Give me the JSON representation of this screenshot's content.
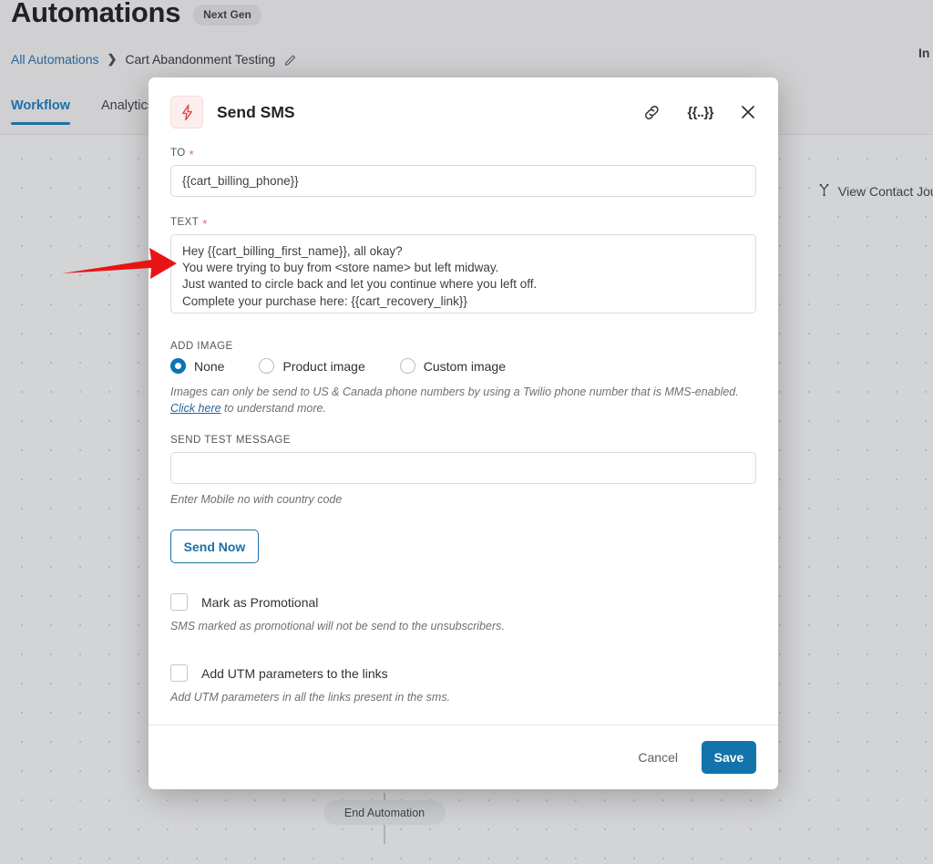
{
  "header": {
    "title": "Automations",
    "badge": "Next Gen",
    "right_cut_text": "In",
    "breadcrumb": {
      "root": "All Automations",
      "separator": "❯",
      "current": "Cart Abandonment Testing",
      "edit_icon": "pencil-icon"
    },
    "tabs": [
      {
        "label": "Workflow",
        "active": true
      },
      {
        "label": "Analytics",
        "active": false
      }
    ]
  },
  "canvas": {
    "view_journey_label": "View Contact Jour",
    "view_journey_icon": "branch-icon",
    "end_node_label": "End Automation"
  },
  "modal": {
    "icon": "lightning-bolt-icon",
    "title": "Send SMS",
    "header_actions": [
      {
        "name": "link-icon",
        "glyph": "link"
      },
      {
        "name": "merge-tag-icon",
        "glyph": "{{..}}"
      },
      {
        "name": "close-icon",
        "glyph": "✕"
      }
    ],
    "to": {
      "label": "TO",
      "required": "*",
      "value": "{{cart_billing_phone}}"
    },
    "text": {
      "label": "TEXT",
      "required": "*",
      "value": "Hey {{cart_billing_first_name}}, all okay?\nYou were trying to buy from <store name> but left midway.\nJust wanted to circle back and let you continue where you left off.\nComplete your purchase here: {{cart_recovery_link}}"
    },
    "add_image": {
      "label": "ADD IMAGE",
      "options": [
        {
          "label": "None",
          "selected": true
        },
        {
          "label": "Product image",
          "selected": false
        },
        {
          "label": "Custom image",
          "selected": false
        }
      ],
      "helper_prefix": "Images can only be send to US & Canada phone numbers by using a Twilio phone number that is MMS-enabled.",
      "helper_link": "Click here",
      "helper_suffix": " to understand more."
    },
    "send_test": {
      "label": "SEND TEST MESSAGE",
      "value": "",
      "placeholder": "",
      "helper": "Enter Mobile no with country code",
      "send_button": "Send Now"
    },
    "promotional": {
      "label": "Mark as Promotional",
      "checked": false,
      "helper": "SMS marked as promotional will not be send to the unsubscribers."
    },
    "utm": {
      "label": "Add UTM parameters to the links",
      "checked": false,
      "helper": "Add UTM parameters in all the links present in the sms."
    },
    "footer": {
      "cancel": "Cancel",
      "save": "Save"
    }
  },
  "annotation": {
    "arrow": "red-arrow-pointing-right",
    "color": "#e81414"
  },
  "colors": {
    "accent_blue": "#1274ab",
    "link_blue": "#2a6496",
    "radio_blue": "#0a72b5",
    "required_red": "#e06666",
    "bolt_red": "#e04b4b",
    "canvas_bg": "#d3d4d6"
  }
}
